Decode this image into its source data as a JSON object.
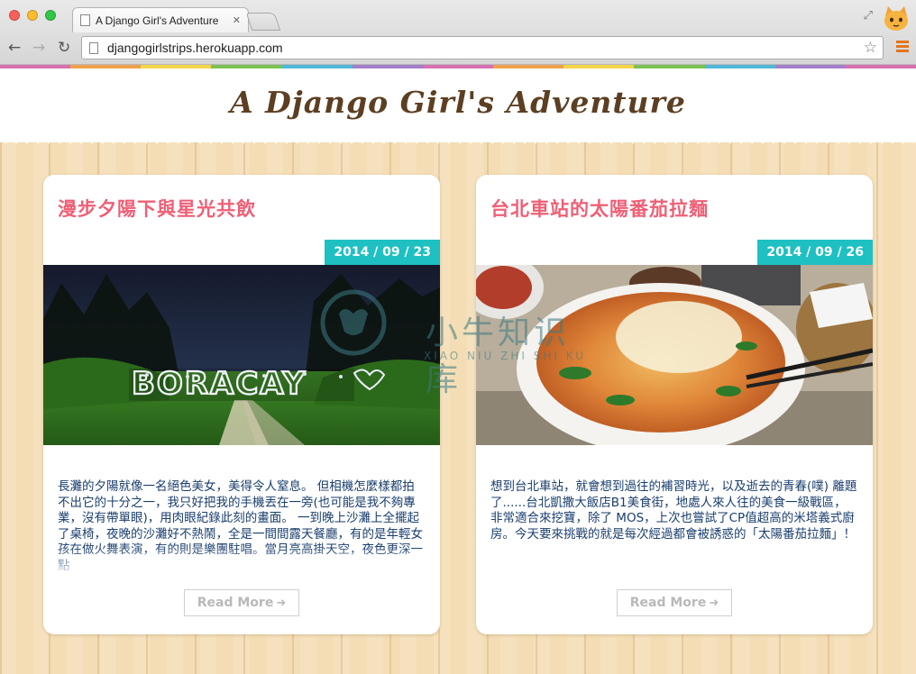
{
  "browser": {
    "tab_title": "A Django Girl's Adventure",
    "tab_close": "✕",
    "url": "djangogirlstrips.herokuapp.com",
    "back": "←",
    "forward": "→",
    "reload": "↻",
    "star": "☆",
    "resize": "⤢",
    "strip_colors": [
      "#d76fb0",
      "#eea14c",
      "#f3d649",
      "#7cc252",
      "#4fb7d8",
      "#a47ecb",
      "#d76fb0",
      "#eea14c",
      "#f3d649",
      "#7cc252",
      "#4fb7d8",
      "#a47ecb",
      "#d76fb0"
    ]
  },
  "site": {
    "title": "A Django Girl's Adventure",
    "title_color": "#5c3f22"
  },
  "posts": [
    {
      "title": "漫步夕陽下與星光共飲",
      "date": "2014 / 09 / 23",
      "image_icon": "boracay-night-photo",
      "image_caption": "BORACAY",
      "excerpt": "長灘的夕陽就像一名絕色美女，美得令人窒息。 但相機怎麼樣都拍不出它的十分之一，我只好把我的手機丟在一旁(也可能是我不夠專業，沒有帶單眼)，用肉眼紀錄此刻的畫面。 一到晚上沙灘上全擺起了桌椅，夜晚的沙灘好不熱鬧，全是一間間露天餐廳，有的是年輕女孩在做火舞表演，有的則是樂團駐唱。當月亮高掛天空，夜色更深一點",
      "read_more": "Read More"
    },
    {
      "title": "台北車站的太陽番茄拉麵",
      "date": "2014 / 09 / 26",
      "image_icon": "tomato-ramen-photo",
      "excerpt": "想到台北車站，就會想到過往的補習時光，以及逝去的青春(噗) 離題了......台北凱撒大飯店B1美食街，地處人來人往的美食一級戰區，非常適合來挖寶，除了 MOS，上次也嘗試了CP值超高的米塔義式廚房。今天要來挑戰的就是每次經過都會被誘惑的「太陽番茄拉麵」！",
      "read_more": "Read More"
    }
  ],
  "watermark": {
    "text": "小牛知识库",
    "sub": "XIAO NIU ZHI SHI KU"
  },
  "colors": {
    "accent_title": "#ef5f75",
    "date_badge": "#1ec0c2",
    "excerpt_text": "#1a3e6e",
    "wood_bg": "#f4ddb4"
  }
}
